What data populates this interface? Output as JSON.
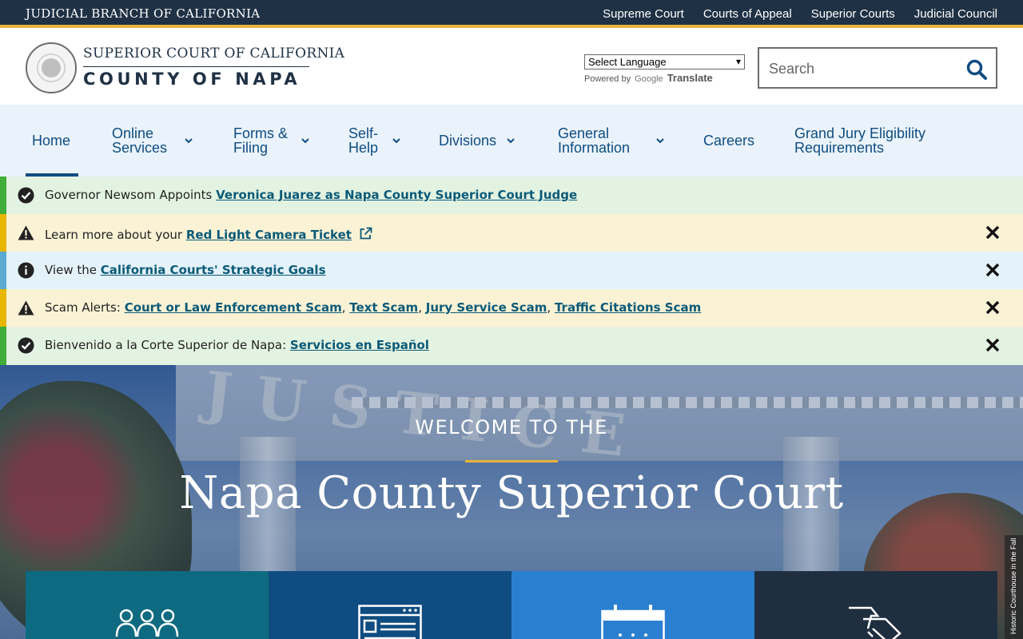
{
  "topbar": {
    "branch": "JUDICIAL BRANCH OF CALIFORNIA",
    "links": [
      "Supreme Court",
      "Courts of Appeal",
      "Superior Courts",
      "Judicial Council"
    ]
  },
  "header": {
    "line1": "SUPERIOR COURT OF CALIFORNIA",
    "line2": "COUNTY OF NAPA",
    "language_select": "Select Language",
    "powered_by": "Powered by",
    "google": "Google",
    "translate": "Translate",
    "search_placeholder": "Search"
  },
  "nav": {
    "items": [
      {
        "label": "Home",
        "active": true
      },
      {
        "label": "Online Services",
        "has_menu": true
      },
      {
        "label": "Forms & Filing",
        "has_menu": true
      },
      {
        "label": "Self-Help",
        "has_menu": true
      },
      {
        "label": "Divisions",
        "has_menu": true
      },
      {
        "label": "General Information",
        "has_menu": true
      },
      {
        "label": "Careers"
      },
      {
        "label": "Grand Jury Eligibility Requirements"
      }
    ]
  },
  "alerts": [
    {
      "prefix": "Governor Newsom Appoints ",
      "links": [
        "Veronica Juarez as Napa County Superior Court Judge"
      ]
    },
    {
      "prefix": "Learn more about your ",
      "links": [
        "Red Light Camera Ticket"
      ]
    },
    {
      "prefix": "View the ",
      "links": [
        "California Courts' Strategic Goals"
      ]
    },
    {
      "prefix": "Scam Alerts: ",
      "links": [
        "Court or Law Enforcement Scam",
        "Text Scam",
        "Jury Service Scam",
        "Traffic Citations Scam"
      ]
    },
    {
      "prefix": "Bienvenido a la Corte Superior de Napa: ",
      "links": [
        "Servicios en Español"
      ]
    }
  ],
  "hero": {
    "welcome": "WELCOME TO THE",
    "title": "Napa County Superior Court",
    "caption": "Historic Courthouse in the Fall",
    "engraved": "JUSTICE"
  },
  "colors": {
    "navy": "#1f3144",
    "gold": "#e8b33a",
    "link_blue": "#0f4c81",
    "alert_link": "#0b5a78"
  }
}
